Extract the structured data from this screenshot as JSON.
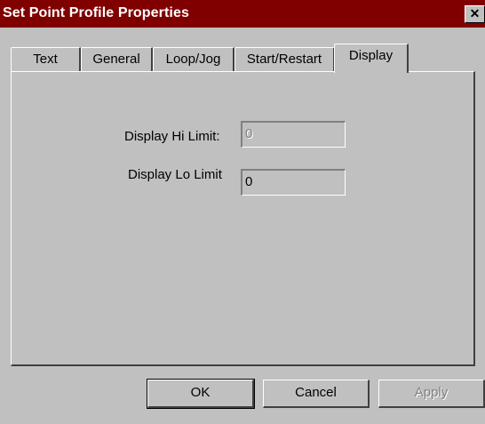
{
  "window": {
    "title": "Set Point Profile Properties",
    "close_glyph": "✕"
  },
  "tabs": [
    {
      "label": "Text"
    },
    {
      "label": "General"
    },
    {
      "label": "Loop/Jog"
    },
    {
      "label": "Start/Restart"
    },
    {
      "label": "Display",
      "active": true
    }
  ],
  "display": {
    "hi_limit_label": "Display Hi Limit:",
    "hi_limit_value": "0",
    "lo_limit_label": "Display Lo Limit",
    "lo_limit_value": "0"
  },
  "buttons": {
    "ok": "OK",
    "cancel": "Cancel",
    "apply": "Apply"
  }
}
